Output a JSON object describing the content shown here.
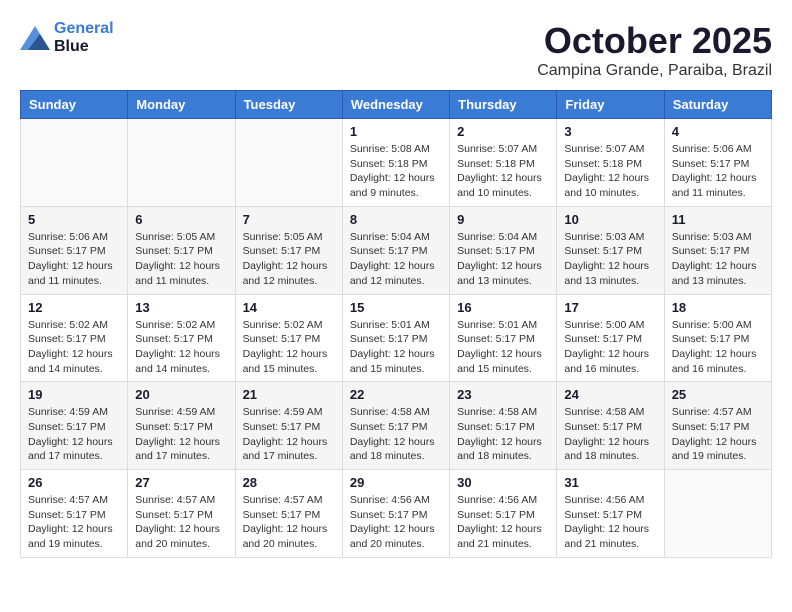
{
  "header": {
    "logo_line1": "General",
    "logo_line2": "Blue",
    "month_title": "October 2025",
    "subtitle": "Campina Grande, Paraiba, Brazil"
  },
  "weekdays": [
    "Sunday",
    "Monday",
    "Tuesday",
    "Wednesday",
    "Thursday",
    "Friday",
    "Saturday"
  ],
  "weeks": [
    [
      {
        "day": "",
        "info": ""
      },
      {
        "day": "",
        "info": ""
      },
      {
        "day": "",
        "info": ""
      },
      {
        "day": "1",
        "info": "Sunrise: 5:08 AM\nSunset: 5:18 PM\nDaylight: 12 hours and 9 minutes."
      },
      {
        "day": "2",
        "info": "Sunrise: 5:07 AM\nSunset: 5:18 PM\nDaylight: 12 hours and 10 minutes."
      },
      {
        "day": "3",
        "info": "Sunrise: 5:07 AM\nSunset: 5:18 PM\nDaylight: 12 hours and 10 minutes."
      },
      {
        "day": "4",
        "info": "Sunrise: 5:06 AM\nSunset: 5:17 PM\nDaylight: 12 hours and 11 minutes."
      }
    ],
    [
      {
        "day": "5",
        "info": "Sunrise: 5:06 AM\nSunset: 5:17 PM\nDaylight: 12 hours and 11 minutes."
      },
      {
        "day": "6",
        "info": "Sunrise: 5:05 AM\nSunset: 5:17 PM\nDaylight: 12 hours and 11 minutes."
      },
      {
        "day": "7",
        "info": "Sunrise: 5:05 AM\nSunset: 5:17 PM\nDaylight: 12 hours and 12 minutes."
      },
      {
        "day": "8",
        "info": "Sunrise: 5:04 AM\nSunset: 5:17 PM\nDaylight: 12 hours and 12 minutes."
      },
      {
        "day": "9",
        "info": "Sunrise: 5:04 AM\nSunset: 5:17 PM\nDaylight: 12 hours and 13 minutes."
      },
      {
        "day": "10",
        "info": "Sunrise: 5:03 AM\nSunset: 5:17 PM\nDaylight: 12 hours and 13 minutes."
      },
      {
        "day": "11",
        "info": "Sunrise: 5:03 AM\nSunset: 5:17 PM\nDaylight: 12 hours and 13 minutes."
      }
    ],
    [
      {
        "day": "12",
        "info": "Sunrise: 5:02 AM\nSunset: 5:17 PM\nDaylight: 12 hours and 14 minutes."
      },
      {
        "day": "13",
        "info": "Sunrise: 5:02 AM\nSunset: 5:17 PM\nDaylight: 12 hours and 14 minutes."
      },
      {
        "day": "14",
        "info": "Sunrise: 5:02 AM\nSunset: 5:17 PM\nDaylight: 12 hours and 15 minutes."
      },
      {
        "day": "15",
        "info": "Sunrise: 5:01 AM\nSunset: 5:17 PM\nDaylight: 12 hours and 15 minutes."
      },
      {
        "day": "16",
        "info": "Sunrise: 5:01 AM\nSunset: 5:17 PM\nDaylight: 12 hours and 15 minutes."
      },
      {
        "day": "17",
        "info": "Sunrise: 5:00 AM\nSunset: 5:17 PM\nDaylight: 12 hours and 16 minutes."
      },
      {
        "day": "18",
        "info": "Sunrise: 5:00 AM\nSunset: 5:17 PM\nDaylight: 12 hours and 16 minutes."
      }
    ],
    [
      {
        "day": "19",
        "info": "Sunrise: 4:59 AM\nSunset: 5:17 PM\nDaylight: 12 hours and 17 minutes."
      },
      {
        "day": "20",
        "info": "Sunrise: 4:59 AM\nSunset: 5:17 PM\nDaylight: 12 hours and 17 minutes."
      },
      {
        "day": "21",
        "info": "Sunrise: 4:59 AM\nSunset: 5:17 PM\nDaylight: 12 hours and 17 minutes."
      },
      {
        "day": "22",
        "info": "Sunrise: 4:58 AM\nSunset: 5:17 PM\nDaylight: 12 hours and 18 minutes."
      },
      {
        "day": "23",
        "info": "Sunrise: 4:58 AM\nSunset: 5:17 PM\nDaylight: 12 hours and 18 minutes."
      },
      {
        "day": "24",
        "info": "Sunrise: 4:58 AM\nSunset: 5:17 PM\nDaylight: 12 hours and 18 minutes."
      },
      {
        "day": "25",
        "info": "Sunrise: 4:57 AM\nSunset: 5:17 PM\nDaylight: 12 hours and 19 minutes."
      }
    ],
    [
      {
        "day": "26",
        "info": "Sunrise: 4:57 AM\nSunset: 5:17 PM\nDaylight: 12 hours and 19 minutes."
      },
      {
        "day": "27",
        "info": "Sunrise: 4:57 AM\nSunset: 5:17 PM\nDaylight: 12 hours and 20 minutes."
      },
      {
        "day": "28",
        "info": "Sunrise: 4:57 AM\nSunset: 5:17 PM\nDaylight: 12 hours and 20 minutes."
      },
      {
        "day": "29",
        "info": "Sunrise: 4:56 AM\nSunset: 5:17 PM\nDaylight: 12 hours and 20 minutes."
      },
      {
        "day": "30",
        "info": "Sunrise: 4:56 AM\nSunset: 5:17 PM\nDaylight: 12 hours and 21 minutes."
      },
      {
        "day": "31",
        "info": "Sunrise: 4:56 AM\nSunset: 5:17 PM\nDaylight: 12 hours and 21 minutes."
      },
      {
        "day": "",
        "info": ""
      }
    ]
  ]
}
